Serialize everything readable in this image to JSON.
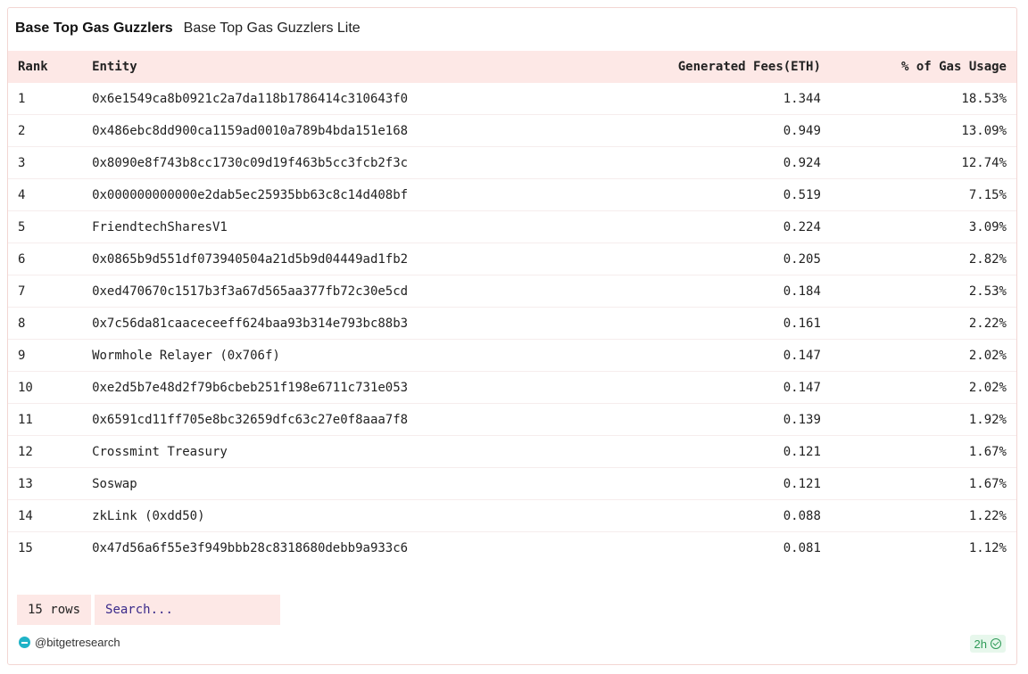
{
  "header": {
    "title": "Base Top Gas Guzzlers",
    "subtitle": "Base Top Gas Guzzlers Lite"
  },
  "table": {
    "columns": [
      "Rank",
      "Entity",
      "Generated Fees(ETH)",
      "% of Gas Usage"
    ],
    "rows": [
      [
        "1",
        "0x6e1549ca8b0921c2a7da118b1786414c310643f0",
        "1.344",
        "18.53%"
      ],
      [
        "2",
        "0x486ebc8dd900ca1159ad0010a789b4bda151e168",
        "0.949",
        "13.09%"
      ],
      [
        "3",
        "0x8090e8f743b8cc1730c09d19f463b5cc3fcb2f3c",
        "0.924",
        "12.74%"
      ],
      [
        "4",
        "0x000000000000e2dab5ec25935bb63c8c14d408bf",
        "0.519",
        "7.15%"
      ],
      [
        "5",
        "FriendtechSharesV1",
        "0.224",
        "3.09%"
      ],
      [
        "6",
        "0x0865b9d551df073940504a21d5b9d04449ad1fb2",
        "0.205",
        "2.82%"
      ],
      [
        "7",
        "0xed470670c1517b3f3a67d565aa377fb72c30e5cd",
        "0.184",
        "2.53%"
      ],
      [
        "8",
        "0x7c56da81caaceceeff624baa93b314e793bc88b3",
        "0.161",
        "2.22%"
      ],
      [
        "9",
        "Wormhole Relayer (0x706f)",
        "0.147",
        "2.02%"
      ],
      [
        "10",
        "0xe2d5b7e48d2f79b6cbeb251f198e6711c731e053",
        "0.147",
        "2.02%"
      ],
      [
        "11",
        "0x6591cd11ff705e8bc32659dfc63c27e0f8aaa7f8",
        "0.139",
        "1.92%"
      ],
      [
        "12",
        "Crossmint Treasury",
        "0.121",
        "1.67%"
      ],
      [
        "13",
        "Soswap",
        "0.121",
        "1.67%"
      ],
      [
        "14",
        "zkLink (0xdd50)",
        "0.088",
        "1.22%"
      ],
      [
        "15",
        "0x47d56a6f55e3f949bbb28c8318680debb9a933c6",
        "0.081",
        "1.12%"
      ]
    ]
  },
  "footer": {
    "rows_label": "15 rows",
    "search_placeholder": "Search...",
    "brand": "@bitgetresearch",
    "brand_icon": "bitget-logo-icon",
    "freshness": "2h",
    "freshness_icon": "check-circle-icon"
  },
  "colors": {
    "header_bg": "#fde8e6",
    "accent": "#3a2a8a",
    "fresh": "#2e9a57",
    "logo": "#1fb3c7"
  }
}
